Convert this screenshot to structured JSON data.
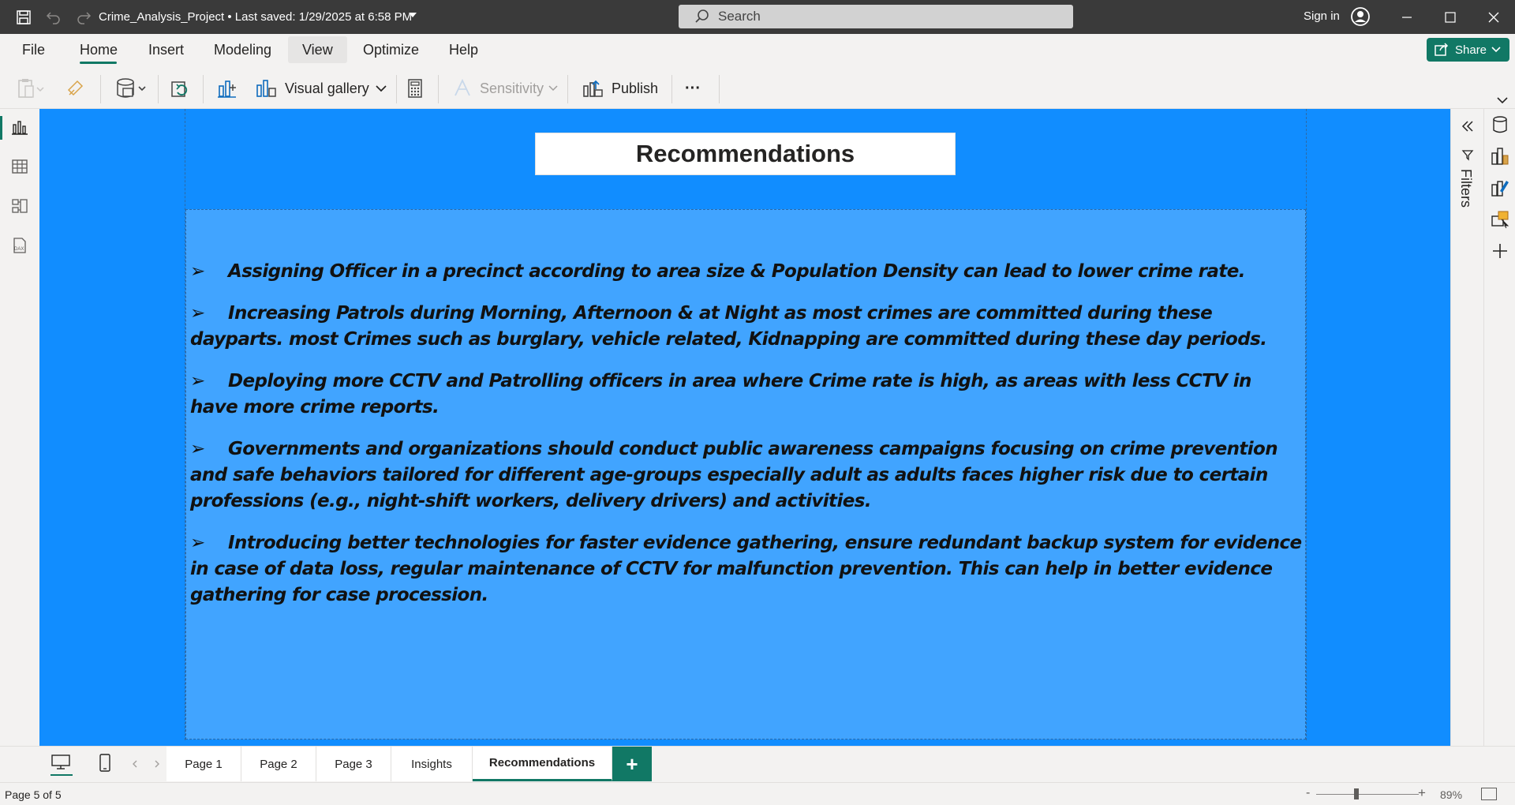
{
  "titlebar": {
    "document_title": "Crime_Analysis_Project • Last saved: 1/29/2025 at 6:58 PM",
    "search_placeholder": "Search",
    "signin_label": "Sign in"
  },
  "menu": {
    "items": [
      "File",
      "Home",
      "Insert",
      "Modeling",
      "View",
      "Optimize",
      "Help"
    ],
    "active": "Home",
    "share_label": "Share"
  },
  "ribbon": {
    "visual_gallery_label": "Visual gallery",
    "sensitivity_label": "Sensitivity",
    "publish_label": "Publish",
    "more_label": "···"
  },
  "report": {
    "title": "Recommendations",
    "bullet_glyph": "➢",
    "bullets": [
      "Assigning Officer in a precinct according to area size &  Population Density can lead to lower crime rate.",
      "Increasing Patrols during Morning, Afternoon & at Night as  most crimes are committed during these dayparts. most Crimes such as burglary, vehicle related, Kidnapping are committed during these day periods.",
      "Deploying more CCTV and Patrolling officers in area where Crime rate is high, as areas with less CCTV in have more crime reports.",
      "Governments and organizations should conduct public awareness campaigns focusing on crime prevention and safe behaviors tailored for different age-groups especially adult as adults faces higher risk due to certain professions (e.g., night-shift workers, delivery drivers) and activities.",
      "Introducing better technologies for faster evidence gathering, ensure redundant backup system for evidence in case of data loss, regular maintenance of CCTV for malfunction prevention. This can help in better evidence gathering for case procession."
    ]
  },
  "filters_label": "Filters",
  "tabs": {
    "pages": [
      "Page 1",
      "Page 2",
      "Page 3",
      "Insights",
      "Recommendations"
    ],
    "active": "Recommendations",
    "add_label": "+"
  },
  "status": {
    "page_count": "Page 5 of 5",
    "zoom_minus": "-",
    "zoom_plus": "+",
    "zoom_percent": "89%",
    "zoom_level": 0.39
  },
  "colors": {
    "accent": "#117865",
    "canvas_bg": "#118dff",
    "textbox_bg": "#41a4ff",
    "titlebar_bg": "#3a3a3a"
  }
}
